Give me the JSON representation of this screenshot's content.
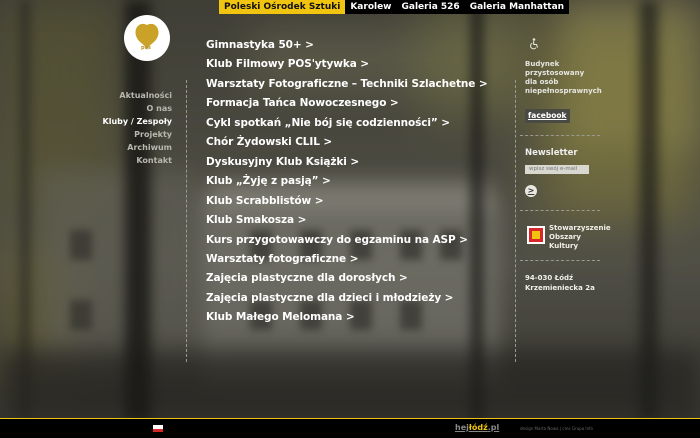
{
  "top_nav": [
    {
      "label": "Poleski Ośrodek Sztuki",
      "active": true
    },
    {
      "label": "Karolew",
      "active": false
    },
    {
      "label": "Galeria 526",
      "active": false
    },
    {
      "label": "Galeria Manhattan",
      "active": false
    }
  ],
  "logo": {
    "text": "pos"
  },
  "left_nav": [
    {
      "label": "Aktualności",
      "current": false
    },
    {
      "label": "O nas",
      "current": false
    },
    {
      "label": "Kluby / Zespoły",
      "current": true
    },
    {
      "label": "Projekty",
      "current": false
    },
    {
      "label": "Archiwum",
      "current": false
    },
    {
      "label": "Kontakt",
      "current": false
    }
  ],
  "main_links": [
    "Gimnastyka 50+ >",
    "Klub Filmowy POS'ytywka >",
    "Warsztaty Fotograficzne – Techniki Szlachetne >",
    "Formacja Tańca Nowoczesnego  >",
    "Cykl spotkań „Nie bój się codzienności”  >",
    "Chór Żydowski CLIL >",
    "Dyskusyjny Klub Książki >",
    "Klub „Żyję z pasją” >",
    "Klub Scrabblistów >",
    "Klub Smakosza >",
    "Kurs przygotowawczy do egzaminu na ASP >",
    "Warsztaty fotograficzne >",
    "Zajęcia plastyczne dla dorosłych >",
    "Zajęcia plastyczne dla dzieci i młodzieży >",
    "Klub Małego Melomana >"
  ],
  "right": {
    "access_icon": "wheelchair-icon",
    "access_text": [
      "Budynek",
      "przystosowany",
      "dla osób",
      "niepełnosprawnych"
    ],
    "facebook_label": "facebook",
    "newsletter_title": "Newsletter",
    "newsletter_placeholder": "wpisz swój e-mail",
    "newsletter_go": ">",
    "org_text": [
      "Stowarzyszenie",
      "Obszary",
      "Kultury"
    ],
    "address": [
      "94-030 Łódź",
      "Krzemieniecka 2a"
    ]
  },
  "footer": {
    "brand_prefix": "hej",
    "brand_main": "łódź",
    "brand_suffix": ".pl",
    "credit": "design Marta Nowa | cms Grupa Info"
  },
  "colors": {
    "accent": "#f1c40f",
    "nav_bg": "#000000",
    "text": "#ffffff"
  }
}
